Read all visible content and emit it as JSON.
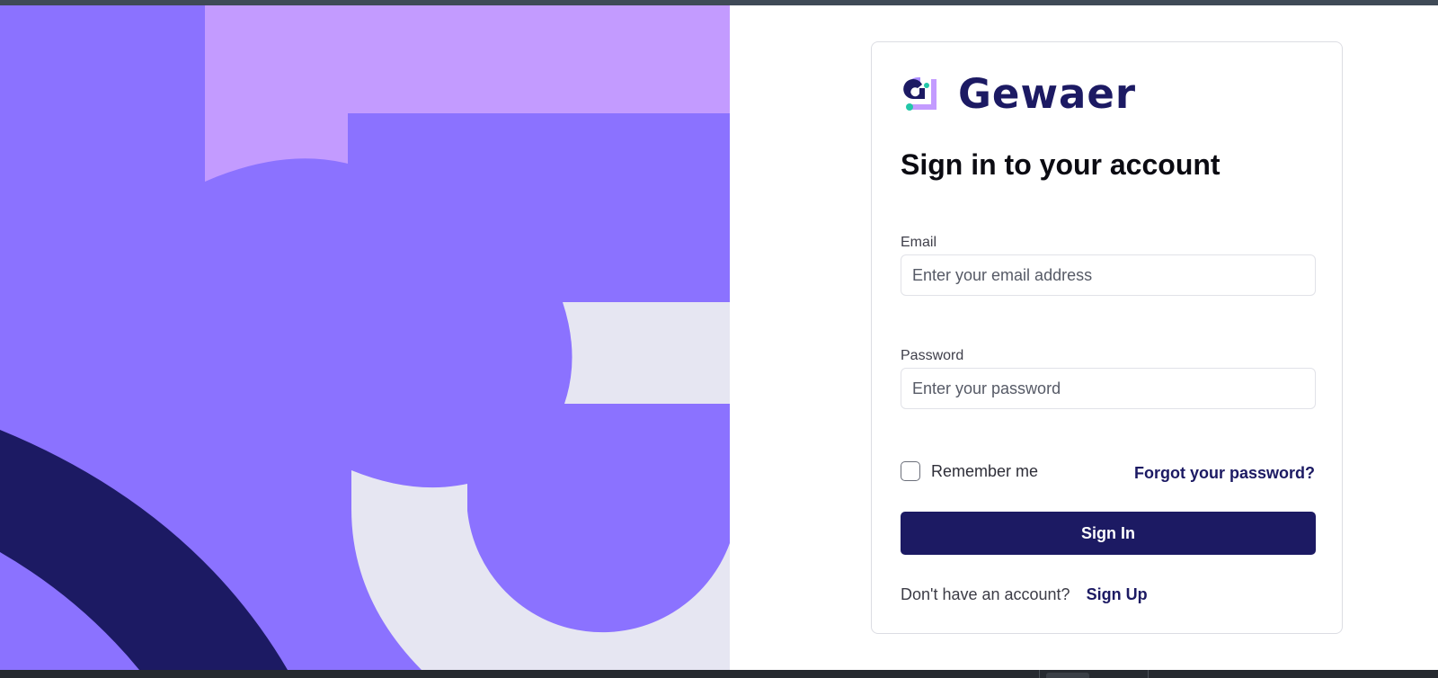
{
  "brand": {
    "name": "Gewaer",
    "logo_icon": "gewaer-logo-mark-icon",
    "color_primary": "#1c1a63",
    "color_accent": "#8b72ff",
    "color_light": "#c39bff"
  },
  "form": {
    "title": "Sign in to your account",
    "email_label": "Email",
    "email_placeholder": "Enter your email address",
    "password_label": "Password",
    "password_placeholder": "Enter your password",
    "remember_label": "Remember me",
    "remember_checked": false,
    "forgot_link": "Forgot your password?",
    "submit_label": "Sign In",
    "signup_prompt": "Don't have an account?",
    "signup_link": "Sign Up"
  }
}
